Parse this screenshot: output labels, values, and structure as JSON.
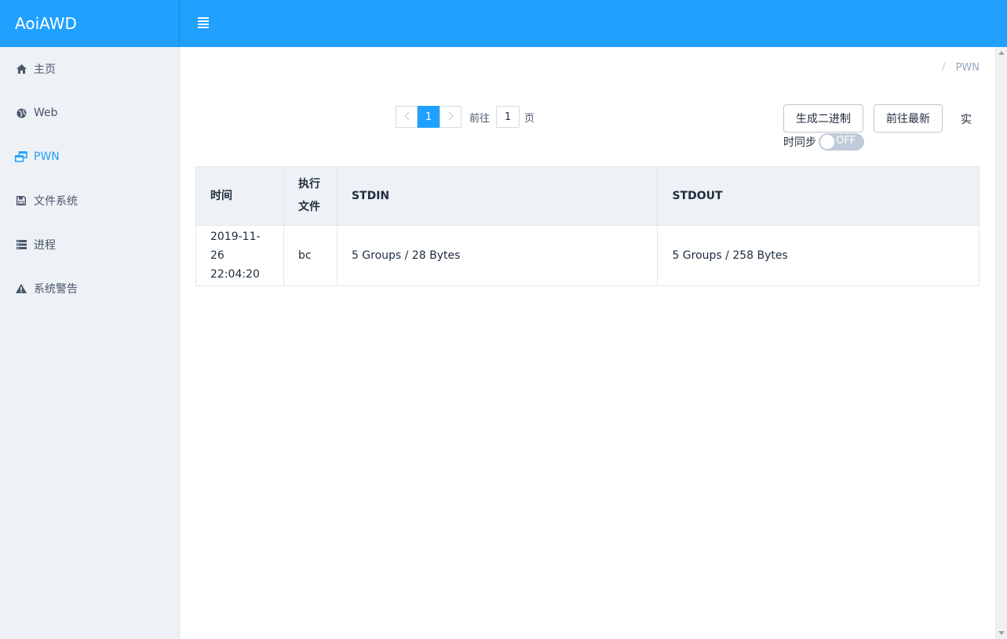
{
  "app": {
    "brand": "AoiAWD"
  },
  "sidebar": {
    "items": [
      {
        "label": "主页",
        "icon": "home-icon"
      },
      {
        "label": "Web",
        "icon": "globe-icon"
      },
      {
        "label": "PWN",
        "icon": "windows-icon",
        "active": true
      },
      {
        "label": "文件系统",
        "icon": "floppy-disk-icon"
      },
      {
        "label": "进程",
        "icon": "list-icon"
      },
      {
        "label": "系统警告",
        "icon": "warning-icon"
      }
    ]
  },
  "breadcrumb": {
    "separator": "/",
    "current": "PWN"
  },
  "pagination": {
    "prev_icon": "chevron-left-icon",
    "next_icon": "chevron-right-icon",
    "current_page": "1",
    "goto_label": "前往",
    "goto_value": "1",
    "page_suffix": "页"
  },
  "toolbar": {
    "generate_label": "生成二进制",
    "latest_label": "前往最新",
    "sync_label_part1": "实",
    "sync_label_part2": "时同步",
    "sync_state": "OFF"
  },
  "table": {
    "headers": {
      "time": "时间",
      "exec_line1": "执行",
      "exec_line2": "文件",
      "stdin": "STDIN",
      "stdout": "STDOUT"
    },
    "rows": [
      {
        "date": "2019-11-26",
        "time": "22:04:20",
        "exec": "bc",
        "stdin": "5 Groups / 28 Bytes",
        "stdout": "5 Groups / 258 Bytes"
      }
    ]
  },
  "colors": {
    "primary": "#20a0ff",
    "sidebar_bg": "#eef1f6"
  }
}
